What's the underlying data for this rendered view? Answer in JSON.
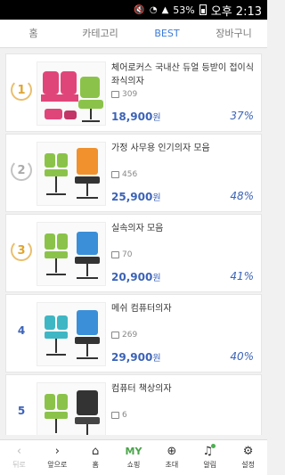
{
  "status": {
    "icons": [
      "mute-icon",
      "wifi-icon",
      "signal-icon"
    ],
    "battery": "53%",
    "time": "오후 2:13"
  },
  "tabs": [
    {
      "label": "홈",
      "active": false
    },
    {
      "label": "카테고리",
      "active": false
    },
    {
      "label": "BEST",
      "active": true
    },
    {
      "label": "장바구니",
      "active": false
    }
  ],
  "products": [
    {
      "rank": "1",
      "title": "체어로커스 국내산 듀얼 등받이 접이식 좌식의자",
      "reviews": "309",
      "price": "18,900",
      "won": "원",
      "discount": "37%"
    },
    {
      "rank": "2",
      "title": "가정 사무용 인기의자 모음",
      "reviews": "456",
      "price": "25,900",
      "won": "원",
      "discount": "48%"
    },
    {
      "rank": "3",
      "title": "실속의자 모음",
      "reviews": "70",
      "price": "20,900",
      "won": "원",
      "discount": "41%"
    },
    {
      "rank": "4",
      "title": "메쉬 컴퓨터의자",
      "reviews": "269",
      "price": "29,900",
      "won": "원",
      "discount": "40%"
    },
    {
      "rank": "5",
      "title": "컴퓨터 책상의자",
      "reviews": "6",
      "price": "",
      "won": "",
      "discount": ""
    }
  ],
  "bottom_nav": [
    {
      "label": "뒤로",
      "icon": "back-icon",
      "enabled": false
    },
    {
      "label": "앞으로",
      "icon": "forward-icon",
      "enabled": true
    },
    {
      "label": "홈",
      "icon": "home-icon",
      "enabled": true
    },
    {
      "label": "쇼핑",
      "icon": "MY",
      "enabled": true
    },
    {
      "label": "초대",
      "icon": "add-friend-icon",
      "enabled": true
    },
    {
      "label": "알림",
      "icon": "bell-icon",
      "enabled": true
    },
    {
      "label": "설정",
      "icon": "gear-icon",
      "enabled": true
    }
  ],
  "colors": {
    "accent": "#3b63b8",
    "tab_active": "#3b7bd8",
    "gold": "#e0a530",
    "silver": "#aaaaaa",
    "green": "#4aa44a"
  }
}
